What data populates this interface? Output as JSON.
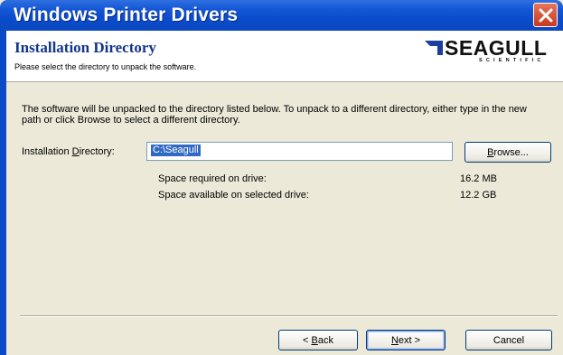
{
  "window": {
    "title": "Windows Printer Drivers"
  },
  "header": {
    "title": "Installation Directory",
    "subtitle": "Please select the directory to unpack the software.",
    "logo_brand": "SEAGULL",
    "logo_sub": "SCIENTIFIC"
  },
  "main": {
    "description": "The software will be unpacked to the directory listed below.  To unpack to a different directory, either type in the new path or click Browse to select a different directory.",
    "dir_label": "Installation Directory:",
    "dir_value": "C:\\Seagull",
    "browse_label": "Browse...",
    "space_required_label": "Space required on drive:",
    "space_required_value": "16.2 MB",
    "space_available_label": "Space available on selected drive:",
    "space_available_value": "12.2 GB"
  },
  "footer": {
    "back_label": "< Back",
    "next_label": "Next >",
    "cancel_label": "Cancel"
  }
}
